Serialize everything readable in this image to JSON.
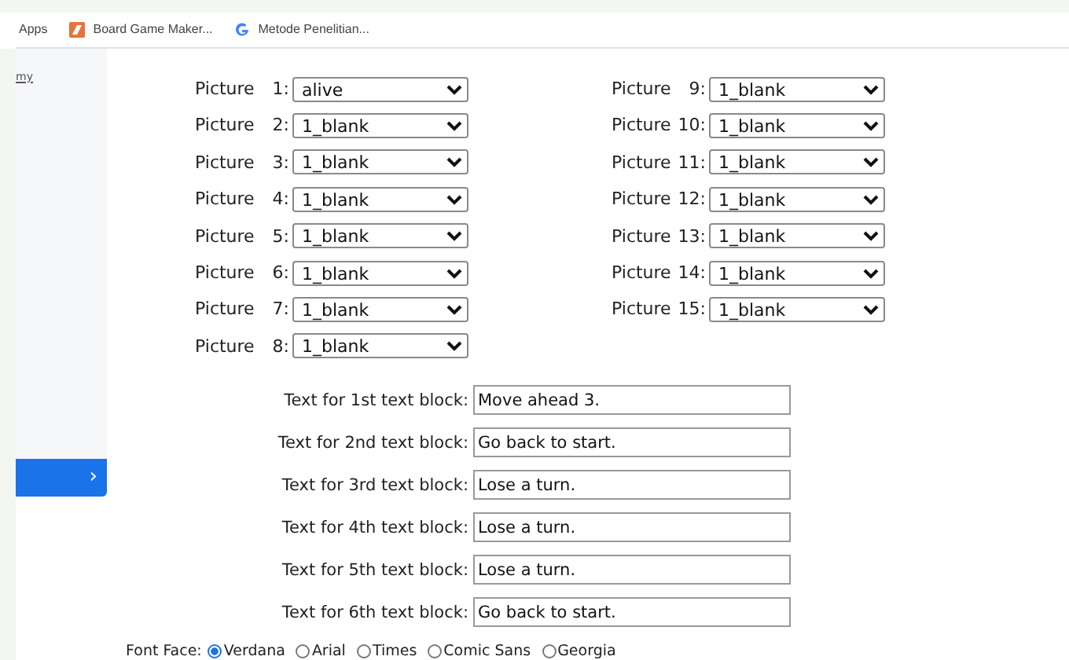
{
  "bookmarks": [
    {
      "label": "Apps",
      "kind": "apps"
    },
    {
      "label": "Board Game Maker...",
      "kind": "tile"
    },
    {
      "label": "Metode Penelitian...",
      "kind": "google"
    }
  ],
  "sidebar": {
    "link": "my",
    "expand_button": {
      "label": "›"
    }
  },
  "pictures": {
    "columns": [
      [
        {
          "label": "Picture",
          "number": "1:",
          "value": "alive"
        },
        {
          "label": "Picture",
          "number": "2:",
          "value": "1_blank"
        },
        {
          "label": "Picture",
          "number": "3:",
          "value": "1_blank"
        },
        {
          "label": "Picture",
          "number": "4:",
          "value": "1_blank"
        },
        {
          "label": "Picture",
          "number": "5:",
          "value": "1_blank"
        },
        {
          "label": "Picture",
          "number": "6:",
          "value": "1_blank"
        },
        {
          "label": "Picture",
          "number": "7:",
          "value": "1_blank"
        },
        {
          "label": "Picture",
          "number": "8:",
          "value": "1_blank"
        }
      ],
      [
        {
          "label": "Picture",
          "number": "9:",
          "value": "1_blank"
        },
        {
          "label": "Picture",
          "number": "10:",
          "value": "1_blank"
        },
        {
          "label": "Picture",
          "number": "11:",
          "value": "1_blank"
        },
        {
          "label": "Picture",
          "number": "12:",
          "value": "1_blank"
        },
        {
          "label": "Picture",
          "number": "13:",
          "value": "1_blank"
        },
        {
          "label": "Picture",
          "number": "14:",
          "value": "1_blank"
        },
        {
          "label": "Picture",
          "number": "15:",
          "value": "1_blank"
        }
      ]
    ]
  },
  "text_blocks": [
    {
      "label": "Text for 1st text block:",
      "value": "Move ahead 3."
    },
    {
      "label": "Text for 2nd text block:",
      "value": "Go back to start."
    },
    {
      "label": "Text for 3rd text block:",
      "value": "Lose a turn."
    },
    {
      "label": "Text for 4th text block:",
      "value": "Lose a turn."
    },
    {
      "label": "Text for 5th text block:",
      "value": "Lose a turn."
    },
    {
      "label": "Text for 6th text block:",
      "value": "Go back to start."
    }
  ],
  "font_face": {
    "label": "Font Face:",
    "options": [
      {
        "label": "Verdana",
        "selected": true
      },
      {
        "label": "Arial",
        "selected": false
      },
      {
        "label": "Times",
        "selected": false
      },
      {
        "label": "Comic Sans",
        "selected": false
      },
      {
        "label": "Georgia",
        "selected": false
      }
    ]
  }
}
